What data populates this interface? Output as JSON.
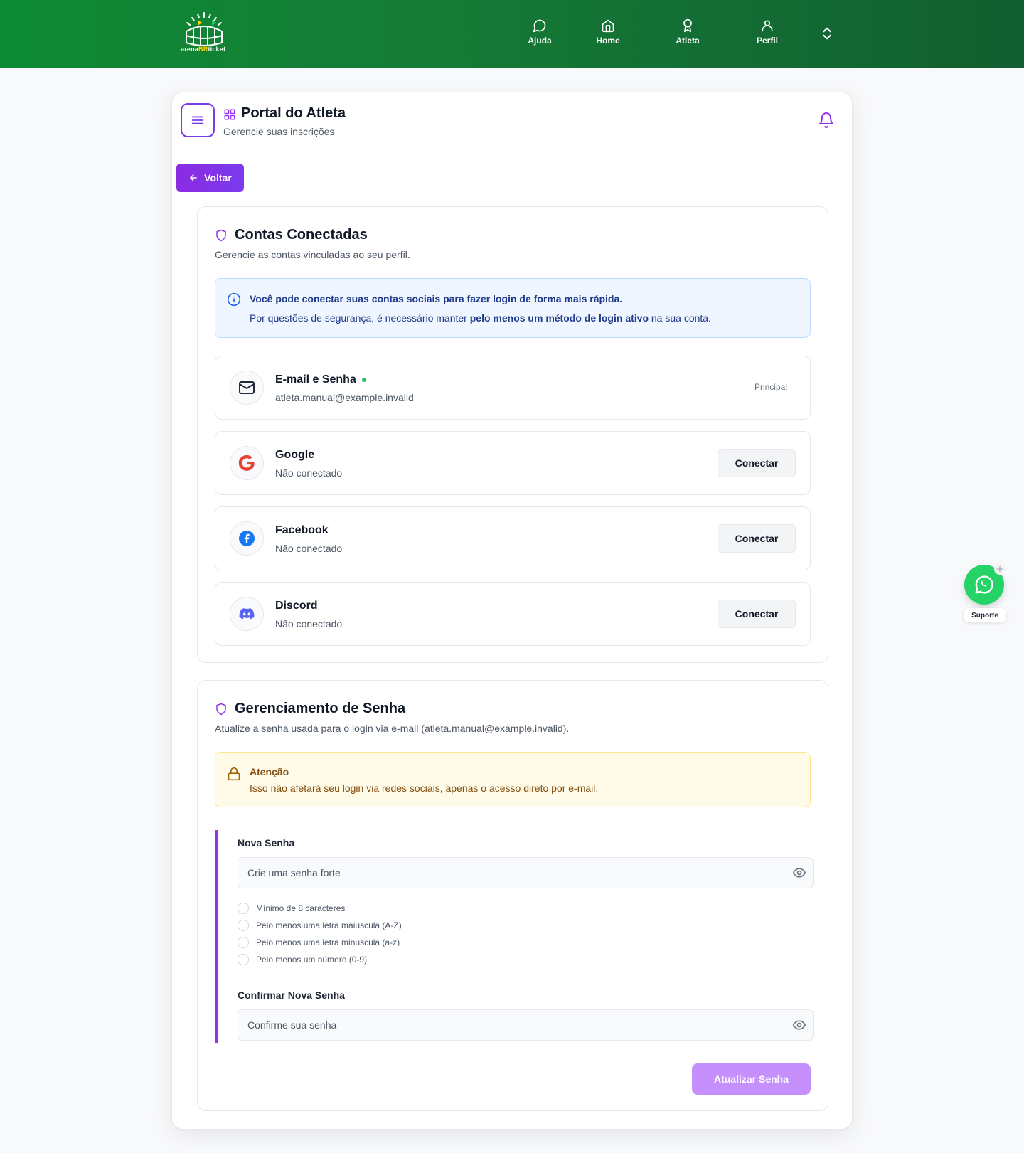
{
  "brand": {
    "logo_text_a": "arena",
    "logo_text_b": "BR",
    "logo_text_c": "ticket"
  },
  "nav": [
    {
      "label": "Ajuda",
      "icon": "chat-bubble-icon"
    },
    {
      "label": "Home",
      "icon": "home-icon"
    },
    {
      "label": "Atleta",
      "icon": "medal-icon"
    },
    {
      "label": "Perfil",
      "icon": "user-icon"
    }
  ],
  "header": {
    "title": "Portal do Atleta",
    "subtitle": "Gerencie suas inscrições"
  },
  "back_label": "Voltar",
  "connected": {
    "title": "Contas Conectadas",
    "subtitle": "Gerencie as contas vinculadas ao seu perfil.",
    "info_line1": "Você pode conectar suas contas sociais para fazer login de forma mais rápida.",
    "info_line2_a": "Por questões de segurança, é necessário manter ",
    "info_line2_b": "pelo menos um método de login ativo",
    "info_line2_c": " na sua conta.",
    "accounts": [
      {
        "name": "E-mail e Senha",
        "status": "atleta.manual@example.invalid",
        "tag": "Principal"
      },
      {
        "name": "Google",
        "status": "Não conectado",
        "button": "Conectar"
      },
      {
        "name": "Facebook",
        "status": "Não conectado",
        "button": "Conectar"
      },
      {
        "name": "Discord",
        "status": "Não conectado",
        "button": "Conectar"
      }
    ]
  },
  "password": {
    "title": "Gerenciamento de Senha",
    "subtitle": "Atualize a senha usada para o login via e-mail (atleta.manual@example.invalid).",
    "warn_title": "Atenção",
    "warn_text": "Isso não afetará seu login via redes sociais, apenas o acesso direto por e-mail.",
    "new_label": "Nova Senha",
    "new_placeholder": "Crie uma senha forte",
    "requirements": [
      "Mínimo de 8 caracteres",
      "Pelo menos uma letra maiúscula (A-Z)",
      "Pelo menos uma letra minúscula (a-z)",
      "Pelo menos um número (0-9)"
    ],
    "confirm_label": "Confirmar Nova Senha",
    "confirm_placeholder": "Confirme sua senha",
    "submit": "Atualizar Senha"
  },
  "support_label": "Suporte",
  "colors": {
    "brand_green": "#157a36",
    "accent_purple": "#7c3aed",
    "success": "#22c55e"
  }
}
